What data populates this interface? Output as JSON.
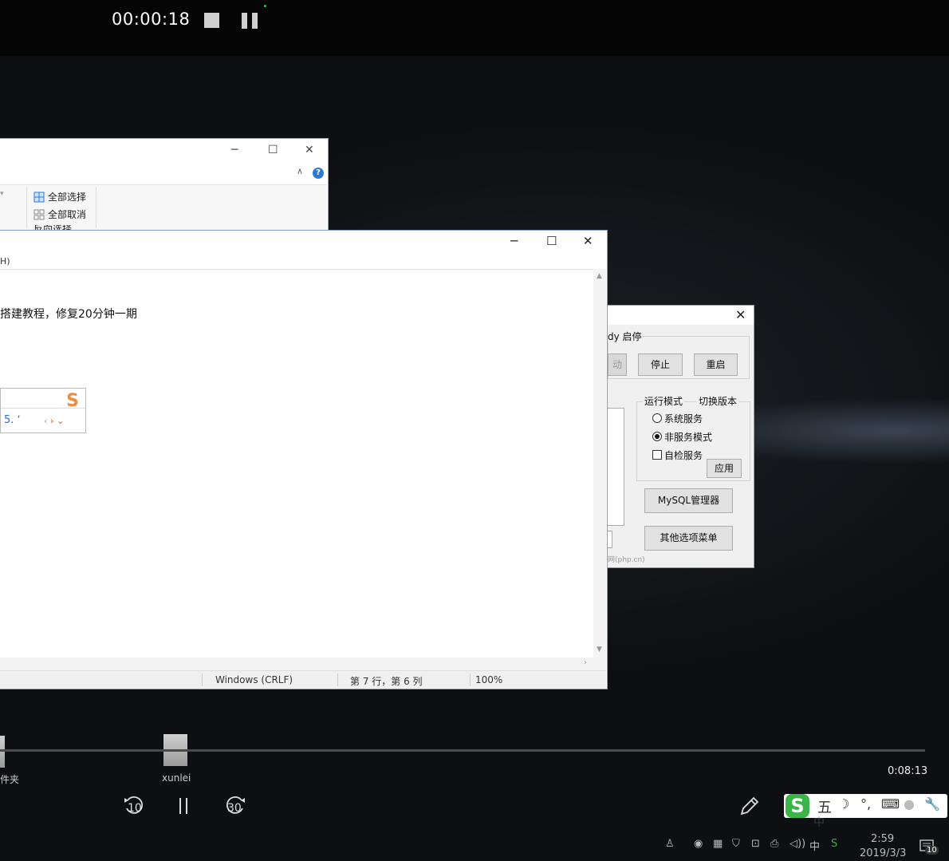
{
  "recorder": {
    "elapsed": "00:00:18"
  },
  "explorer": {
    "ribbon_items": [
      "全部选择",
      "全部取消",
      "反向选择"
    ],
    "help": "?"
  },
  "notepad": {
    "menu_fragment": "H)",
    "line_text": "搭建教程，修复20分钟一期",
    "status": {
      "encoding": "Windows (CRLF)",
      "position": "第 7 行，第 6 列",
      "zoom": "100%"
    }
  },
  "ime": {
    "candidate": "5. ʻ",
    "logo": "S"
  },
  "phpstudy": {
    "status_label": "dy 启停",
    "buttons": {
      "start": "动",
      "stop": "停止",
      "restart": "重启",
      "apply": "应用",
      "mysql": "MySQL管理器",
      "other": "其他选项菜单"
    },
    "mode_title": "运行模式",
    "switch_version": "切换版本",
    "options": {
      "system_service": "系统服务",
      "non_service": "非服务模式",
      "self_check": "自检服务"
    },
    "footer": "网(php.cn)"
  },
  "player": {
    "total_time": "0:08:13",
    "rewind_seconds": "10",
    "forward_seconds": "30",
    "progress_fraction": 0.0
  },
  "desktop": {
    "icons": [
      {
        "label": "件夹"
      },
      {
        "label": "xunlei"
      }
    ]
  },
  "sogou": {
    "logo": "S",
    "mode": "五",
    "sub": "中"
  },
  "taskbar": {
    "ime_indicator": "中",
    "time": "2:59",
    "date": "2019/3/3",
    "notifications": "10"
  }
}
